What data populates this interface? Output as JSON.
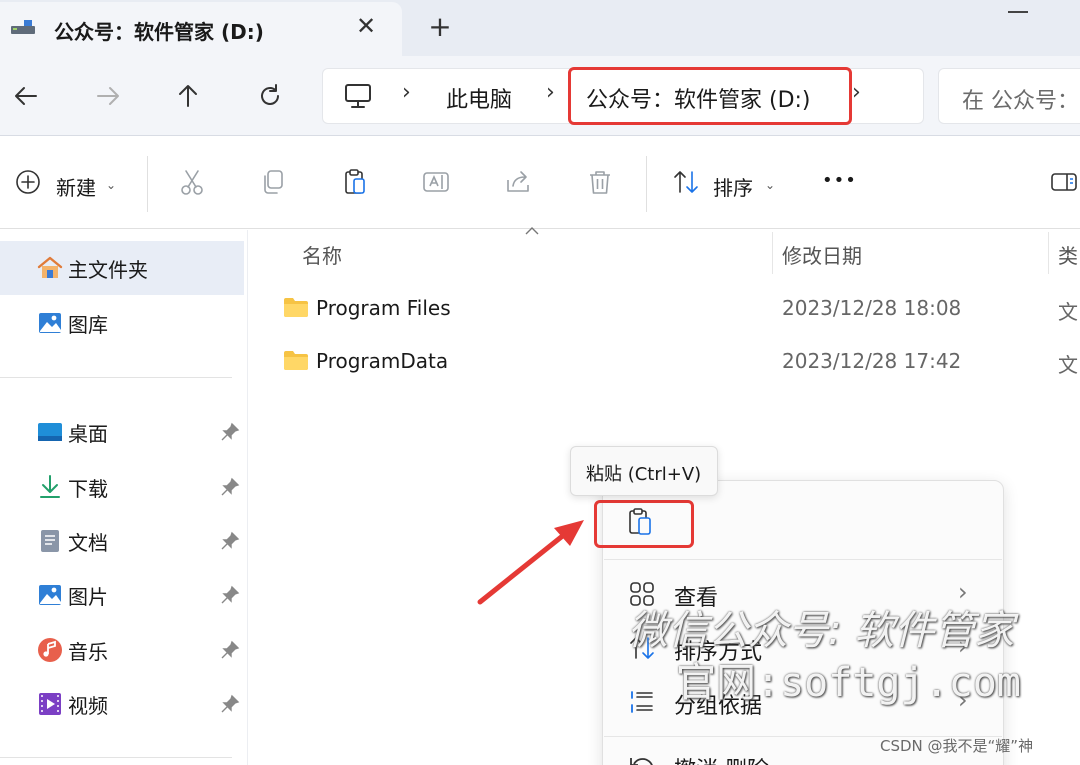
{
  "tab": {
    "title": "公众号：软件管家 (D:)",
    "close": "✕",
    "new_tab": "+"
  },
  "address": {
    "crumbs": [
      "此电脑",
      "公众号：软件管家 (D:)"
    ],
    "separator": "›",
    "search_placeholder": "在 公众号："
  },
  "toolbar": {
    "new_label": "新建",
    "sort_label": "排序",
    "more_label": "•••"
  },
  "sidebar": {
    "quick": [
      {
        "label": "主文件夹",
        "icon": "home-icon"
      },
      {
        "label": "图库",
        "icon": "gallery-icon"
      }
    ],
    "pinned": [
      {
        "label": "桌面",
        "icon": "desktop-icon"
      },
      {
        "label": "下载",
        "icon": "download-icon"
      },
      {
        "label": "文档",
        "icon": "document-icon"
      },
      {
        "label": "图片",
        "icon": "picture-icon"
      },
      {
        "label": "音乐",
        "icon": "music-icon"
      },
      {
        "label": "视频",
        "icon": "video-icon"
      }
    ]
  },
  "file_list": {
    "columns": [
      "名称",
      "修改日期",
      "类"
    ],
    "rows": [
      {
        "name": "Program Files",
        "modified": "2023/12/28 18:08",
        "type": "文"
      },
      {
        "name": "ProgramData",
        "modified": "2023/12/28 17:42",
        "type": "文"
      }
    ]
  },
  "context_menu": {
    "tooltip": "粘贴 (Ctrl+V)",
    "items": [
      {
        "label": "查看",
        "icon": "view-grid-icon",
        "has_submenu": true
      },
      {
        "label": "排序方式",
        "icon": "sort-icon",
        "has_submenu": true
      },
      {
        "label": "分组依据",
        "icon": "group-icon",
        "has_submenu": true
      },
      {
        "label": "撤消 删除",
        "icon": "undo-icon",
        "has_submenu": false
      }
    ],
    "chevron": "›"
  },
  "watermark": {
    "line1": "微信公众号: 软件管家",
    "line2": "官网:softgj.com"
  },
  "credit": "CSDN @我不是“耀”神",
  "colors": {
    "highlight_red": "#e53935",
    "folder_yellow": "#f6c344",
    "accent_blue": "#1a73e8"
  }
}
